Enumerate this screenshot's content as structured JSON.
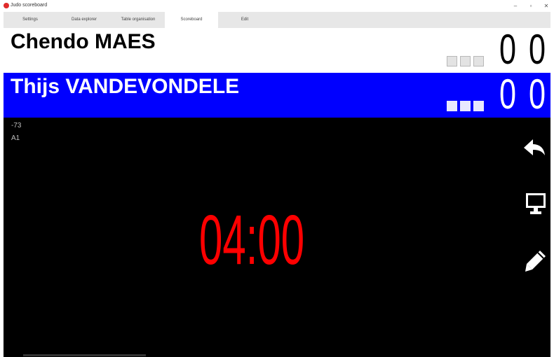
{
  "app": {
    "title": "Judo scoreboard"
  },
  "window_controls": {
    "minimize": "–",
    "maximize": "▫",
    "close": "✕"
  },
  "tabs": [
    {
      "label": "Settings"
    },
    {
      "label": "Data explorer"
    },
    {
      "label": "Table organisation"
    },
    {
      "label": "Scoreboard"
    },
    {
      "label": "Edit"
    }
  ],
  "active_tab": "Scoreboard",
  "player_white": {
    "name": "Chendo MAES",
    "score_1": "0",
    "score_2": "0",
    "penalty_boxes": 3,
    "color": "#ffffff"
  },
  "player_blue": {
    "name": "Thijs VANDEVONDELE",
    "score_1": "0",
    "score_2": "0",
    "penalty_boxes": 3,
    "color": "#0000ff"
  },
  "match": {
    "category": "-73",
    "mat": "A1",
    "timer": "04:00",
    "timer_color": "#ff0000"
  },
  "icons": {
    "undo": "undo-icon",
    "display": "monitor-icon",
    "edit": "pencil-icon"
  }
}
